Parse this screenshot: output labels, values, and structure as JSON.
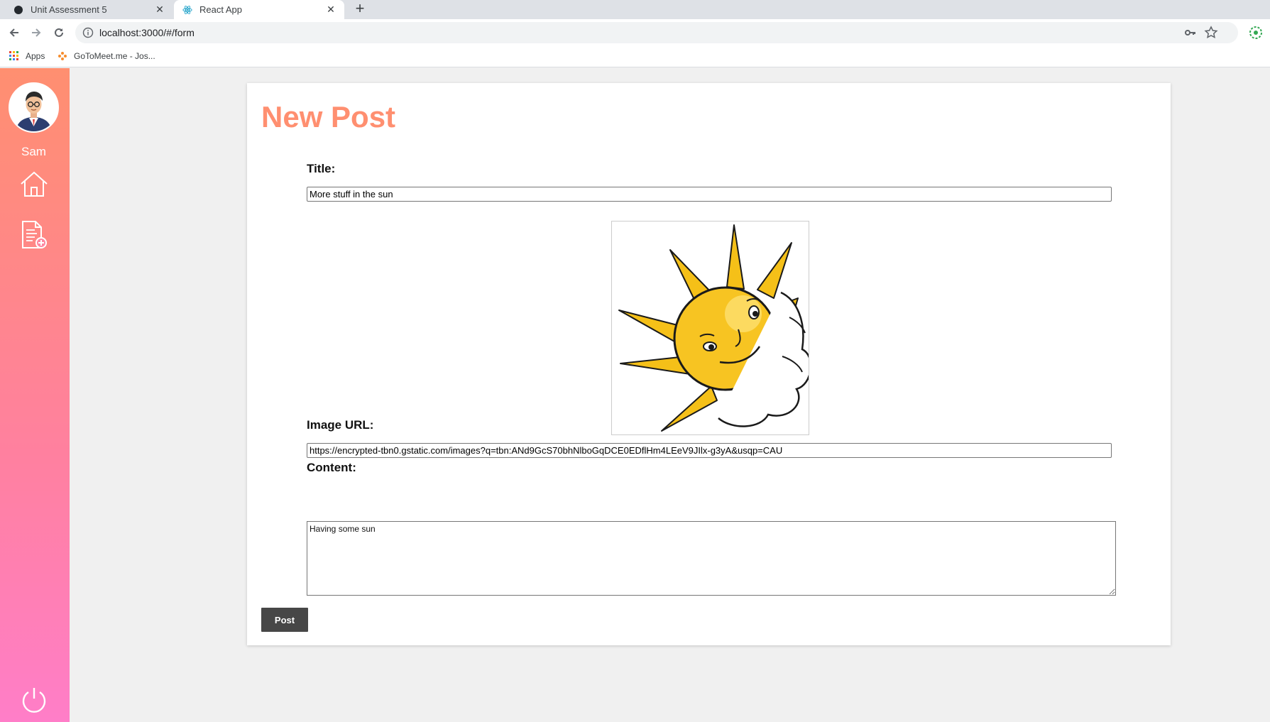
{
  "browser": {
    "tabs": [
      {
        "label": "Unit Assessment 5",
        "active": false
      },
      {
        "label": "React App",
        "active": true
      }
    ],
    "url": "localhost:3000/#/form",
    "bookmarks": [
      {
        "label": "Apps"
      },
      {
        "label": "GoToMeet.me - Jos..."
      }
    ]
  },
  "sidebar": {
    "username": "Sam",
    "items": [
      {
        "icon": "home-icon"
      },
      {
        "icon": "new-post-icon"
      },
      {
        "icon": "power-icon"
      }
    ],
    "gradient": [
      "#ff8f70",
      "#ff7ec8"
    ]
  },
  "form": {
    "heading": "New Post",
    "title_label": "Title:",
    "title_value": "More stuff in the sun",
    "image_label": "Image URL:",
    "image_value": "https://encrypted-tbn0.gstatic.com/images?q=tbn:ANd9GcS70bhNlboGqDCE0EDflHm4LEeV9JIlx-g3yA&usqp=CAU",
    "content_label": "Content:",
    "content_value": "Having some sun",
    "submit_label": "Post",
    "accent": "#ff8f70"
  }
}
